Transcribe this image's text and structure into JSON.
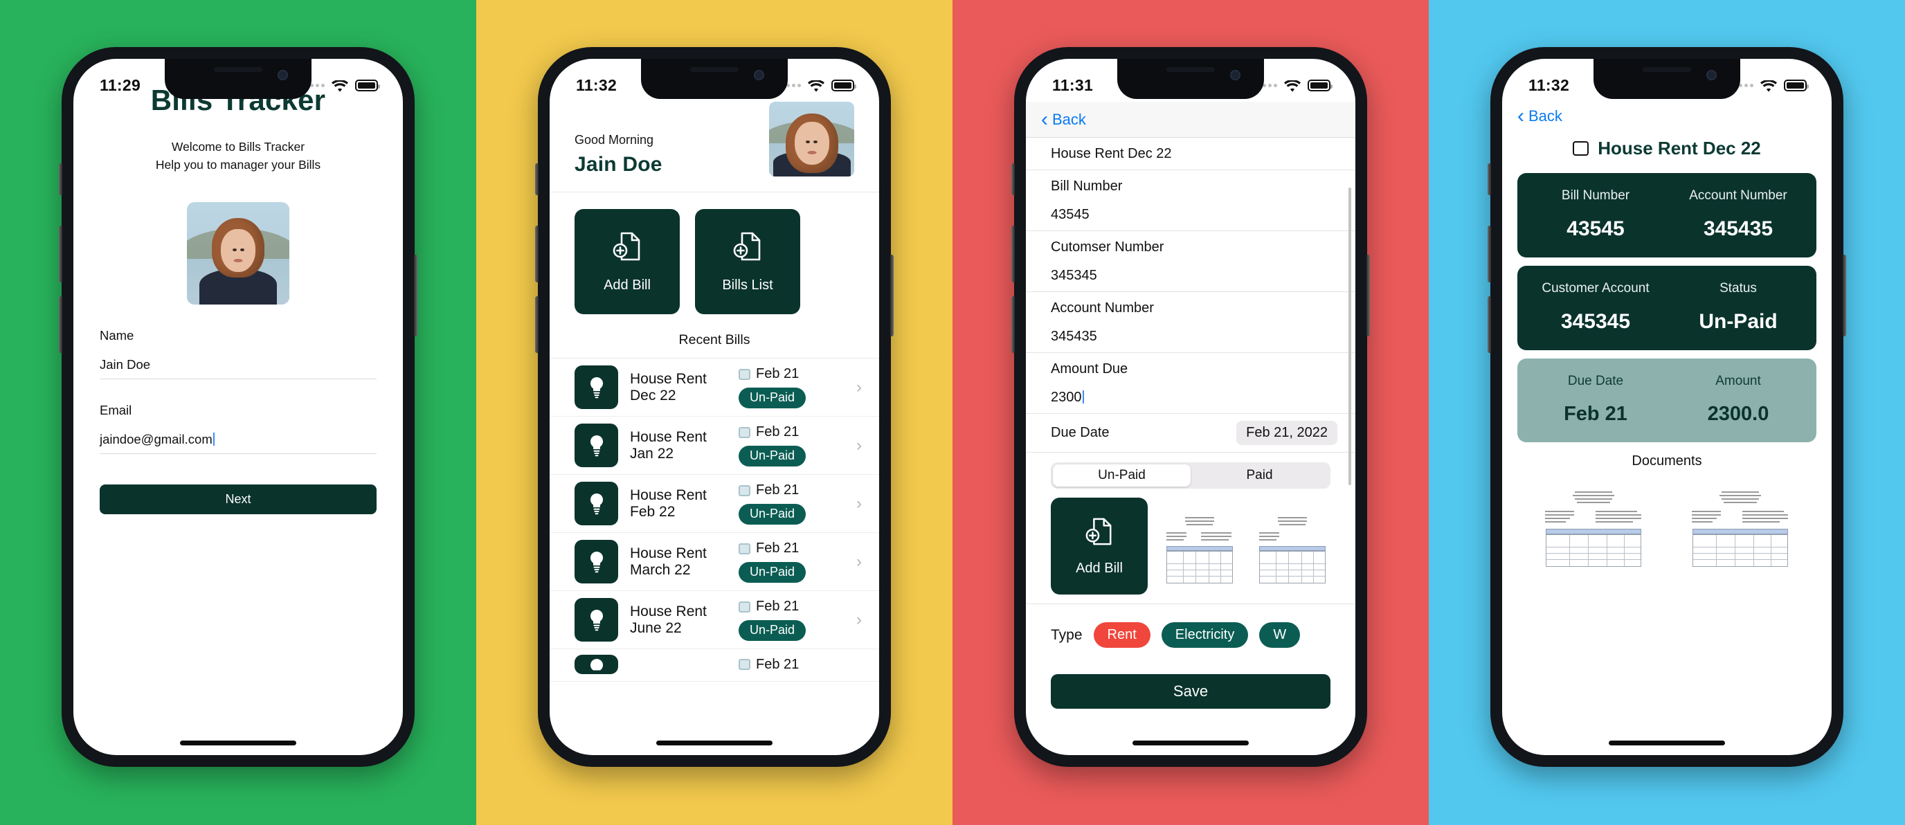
{
  "panels": {
    "colors": {
      "green": "#28b25b",
      "yellow": "#f2c94c",
      "red": "#ea5a5a",
      "blue": "#52c8ef",
      "brand_dark": "#0a332c",
      "pill_green": "#0b5d53",
      "chip_red": "#f0463c",
      "muted_card": "#8db2ad",
      "link_blue": "#0a7bf2"
    }
  },
  "screen1": {
    "status": {
      "time": "11:29"
    },
    "title": "Bills Tracker",
    "subtitle_line1": "Welcome to Bills Tracker",
    "subtitle_line2": "Help you to manager your Bills",
    "avatar_name": "user-avatar",
    "name_label": "Name",
    "name_value": "Jain Doe",
    "email_label": "Email",
    "email_value": "jaindoe@gmail.com",
    "next_button": "Next"
  },
  "screen2": {
    "status": {
      "time": "11:32"
    },
    "greeting": "Good Morning",
    "user_name": "Jain Doe",
    "tiles": [
      {
        "label": "Add Bill",
        "icon": "document-plus-icon"
      },
      {
        "label": "Bills List",
        "icon": "document-plus-icon"
      }
    ],
    "recent_heading": "Recent Bills",
    "bills": [
      {
        "name": "House Rent Dec 22",
        "date": "Feb 21",
        "status": "Un-Paid",
        "icon": "lightbulb-icon"
      },
      {
        "name": "House Rent Jan 22",
        "date": "Feb 21",
        "status": "Un-Paid",
        "icon": "lightbulb-icon"
      },
      {
        "name": "House Rent Feb 22",
        "date": "Feb 21",
        "status": "Un-Paid",
        "icon": "lightbulb-icon"
      },
      {
        "name": "House Rent March 22",
        "date": "Feb 21",
        "status": "Un-Paid",
        "icon": "lightbulb-icon"
      },
      {
        "name": "House Rent June 22",
        "date": "Feb 21",
        "status": "Un-Paid",
        "icon": "lightbulb-icon"
      },
      {
        "name": "",
        "date": "Feb 21",
        "status": "",
        "icon": "lightbulb-icon"
      }
    ]
  },
  "screen3": {
    "status": {
      "time": "11:31"
    },
    "back_label": "Back",
    "bill_title": "House Rent Dec 22",
    "fields": [
      {
        "label": "Bill Number",
        "value": "43545"
      },
      {
        "label": "Cutomser Number",
        "value": "345345"
      },
      {
        "label": "Account Number",
        "value": "345435"
      },
      {
        "label": "Amount Due",
        "value": "2300"
      }
    ],
    "due_date_label": "Due Date",
    "due_date_value": "Feb 21, 2022",
    "segments": [
      {
        "label": "Un-Paid",
        "active": true
      },
      {
        "label": "Paid",
        "active": false
      }
    ],
    "add_bill_label": "Add Bill",
    "type_label": "Type",
    "type_chips": [
      {
        "label": "Rent",
        "color": "red",
        "selected": true
      },
      {
        "label": "Electricity",
        "color": "green",
        "selected": false
      },
      {
        "label": "W",
        "color": "green",
        "selected": false
      }
    ],
    "save_button": "Save"
  },
  "screen4": {
    "status": {
      "time": "11:32"
    },
    "back_label": "Back",
    "page_title": "House Rent Dec 22",
    "card1": [
      {
        "header": "Bill Number",
        "value": "43545"
      },
      {
        "header": "Account Number",
        "value": "345435"
      }
    ],
    "card2": [
      {
        "header": "Customer Account",
        "value": "345345"
      },
      {
        "header": "Status",
        "value": "Un-Paid"
      }
    ],
    "card3": [
      {
        "header": "Due Date",
        "value": "Feb 21"
      },
      {
        "header": "Amount",
        "value": "2300.0"
      }
    ],
    "documents_heading": "Documents",
    "documents_count": 2
  }
}
